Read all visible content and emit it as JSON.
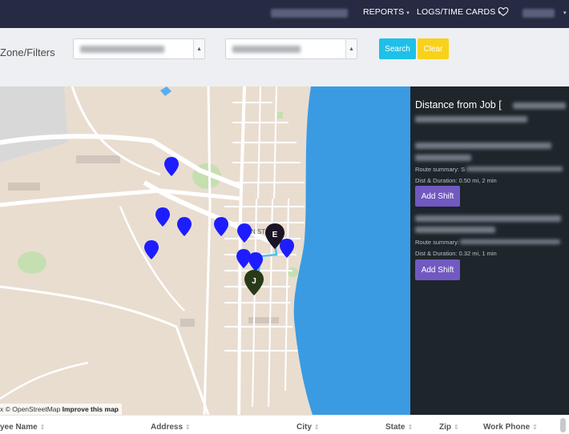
{
  "topbar": {
    "nav": [
      {
        "label": "REPORTS"
      },
      {
        "label": "LOGS/TIME CARDS"
      }
    ],
    "icons": {
      "heart": "heart-icon",
      "caret": "caret-down-icon"
    }
  },
  "filters": {
    "label": "Zone/Filters",
    "search_label": "Search",
    "clear_label": "Clear",
    "colors": {
      "search": "#1ec0e8",
      "clear": "#f8d21a"
    }
  },
  "map": {
    "street_label": "N ST",
    "attribution_prefix": "x © OpenStreetMap",
    "improve_link": "Improve this map",
    "markers": {
      "end": {
        "letter": "E"
      },
      "job": {
        "letter": "J"
      }
    },
    "colors": {
      "water": "#3a9be3",
      "pin": "#1d1dff",
      "end_pin": "#1b1426",
      "job_pin": "#283a18"
    }
  },
  "panel": {
    "title": "Distance from Job [",
    "results": [
      {
        "route_summary_label": "Route summary: S",
        "dist_duration": "Dist & Duration: 0.50 mi, 2 min",
        "add_shift_label": "Add Shift"
      },
      {
        "route_summary_label": "Route summary:",
        "dist_duration": "Dist & Duration: 0.32 mi, 1 min",
        "add_shift_label": "Add Shift"
      }
    ],
    "colors": {
      "background": "#1e252b",
      "button": "#7159c1"
    }
  },
  "table": {
    "columns": [
      {
        "label": "yee Name"
      },
      {
        "label": "Address"
      },
      {
        "label": "City"
      },
      {
        "label": "State"
      },
      {
        "label": "Zip"
      },
      {
        "label": "Work Phone"
      }
    ],
    "sort_glyph": "⇕"
  }
}
